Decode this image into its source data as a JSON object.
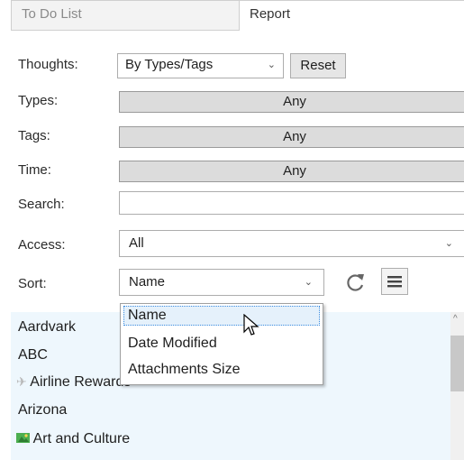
{
  "tabs": [
    {
      "label": "To Do List",
      "active": false
    },
    {
      "label": "Report",
      "active": true
    }
  ],
  "thoughts": {
    "label": "Thoughts:",
    "value": "By Types/Tags",
    "reset_label": "Reset"
  },
  "types": {
    "label": "Types:",
    "value": "Any"
  },
  "tags": {
    "label": "Tags:",
    "value": "Any"
  },
  "time": {
    "label": "Time:",
    "value": "Any"
  },
  "search": {
    "label": "Search:",
    "value": ""
  },
  "access": {
    "label": "Access:",
    "value": "All"
  },
  "sort": {
    "label": "Sort:",
    "value": "Name"
  },
  "sort_menu": {
    "options": [
      "Name",
      "Date Modified",
      "Attachments Size"
    ],
    "highlighted": "Name"
  },
  "list": {
    "items": [
      {
        "label": "Aardvark",
        "icon": null
      },
      {
        "label": "ABC",
        "icon": null
      },
      {
        "label": "Airline Rewards",
        "icon": "airplane-icon"
      },
      {
        "label": "Arizona",
        "icon": null
      },
      {
        "label": "Art and Culture",
        "icon": "art-icon"
      }
    ]
  },
  "colors": {
    "list_bg": "#eef7fd",
    "gray_bar": "#dcdcdc",
    "focus_border": "#3e8ee0"
  }
}
